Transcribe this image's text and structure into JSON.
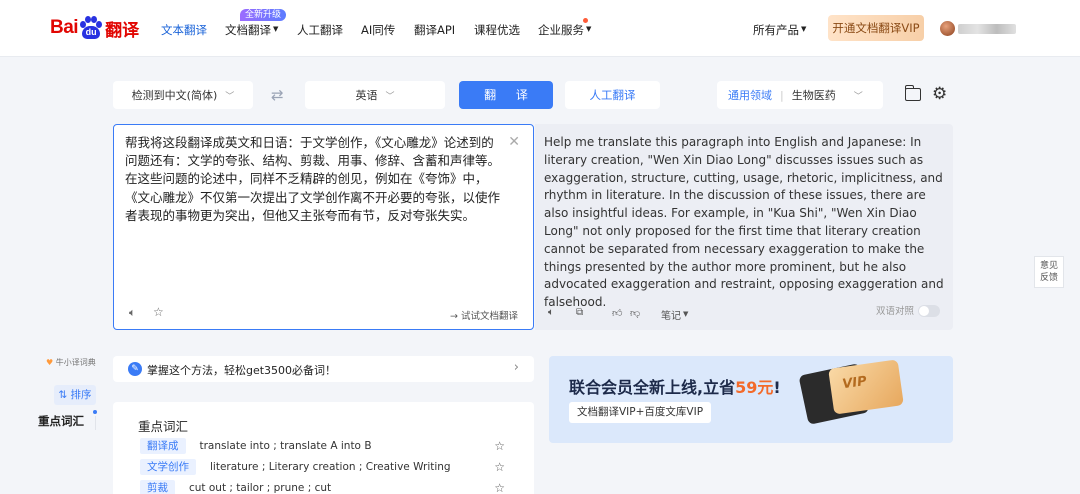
{
  "brand": {
    "bai": "Bai",
    "du": "du",
    "fanyi": "翻译"
  },
  "nav": {
    "text_translate": "文本翻译",
    "doc_translate": "文档翻译",
    "new_badge": "全新升级",
    "human_translate": "人工翻译",
    "ai_simul": "AI同传",
    "api": "翻译API",
    "courses": "课程优选",
    "enterprise": "企业服务",
    "all_products": "所有产品",
    "vip_button": "开通文档翻译VIP"
  },
  "controls": {
    "source_lang": "检测到中文(简体)",
    "target_lang": "英语",
    "translate_button": "翻 译",
    "human_button": "人工翻译",
    "domain_general": "通用领域",
    "domain_selected": "生物医药"
  },
  "source": {
    "text": "帮我将这段翻译成英文和日语：于文学创作，《文心雕龙》论述到的问题还有：文学的夸张、结构、剪裁、用事、修辞、含蓄和声律等。在这些问题的论述中，同样不乏精辟的创见，例如在《夸饰》中，《文心雕龙》不仅第一次提出了文学创作离不开必要的夸张，以使作者表现的事物更为突出，但他又主张夸而有节，反对夸张失实。",
    "doc_link": "→ 试试文档翻译"
  },
  "target": {
    "text": "Help me translate this paragraph into English and Japanese: In literary creation, \"Wen Xin Diao Long\" discusses issues such as exaggeration, structure, cutting, usage, rhetoric, implicitness, and rhythm in literature. In the discussion of these issues, there are also insightful ideas. For example, in \"Kua Shi\", \"Wen Xin Diao Long\" not only proposed for the first time that literary creation cannot be separated from necessary exaggeration to make the things presented by the author more prominent, but he also advocated exaggeration and restraint, opposing exaggeration and falsehood.",
    "notes_label": "笔记",
    "bilingual_label": "双语对照"
  },
  "side": {
    "feedback_line1": "意见",
    "feedback_line2": "反馈"
  },
  "dict": {
    "tab_label": "牛小译词典",
    "sort_label": "⇅ 排序",
    "keyword_label": "重点词汇"
  },
  "tip": {
    "text": "掌握这个方法，轻松get3500必备词！"
  },
  "vocab": {
    "title": "重点词汇",
    "items": [
      {
        "term": "翻译成",
        "def": "translate into ; translate A into B"
      },
      {
        "term": "文学创作",
        "def": "literature ; Literary creation ; Creative Writing"
      },
      {
        "term": "剪裁",
        "def": "cut out ; tailor ; prune ; cut"
      }
    ]
  },
  "banner": {
    "title_pre": "联合会员全新上线,立省",
    "title_hl": "59元",
    "title_post": "!",
    "subtitle": "文档翻译VIP+百度文库VIP",
    "card_text": "VIP"
  },
  "colors": {
    "accent": "#3a7bf6",
    "brand_red": "#e10602",
    "brand_blue": "#2932e1"
  }
}
